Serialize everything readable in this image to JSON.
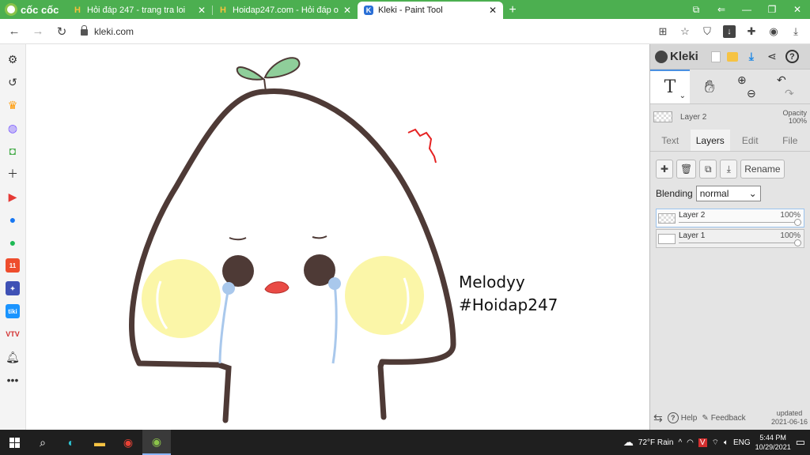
{
  "browser": {
    "brand": "cốc cốc",
    "tabs": [
      {
        "title": "Hỏi đáp 247 - trang tra loi",
        "icon": "hoidap-favicon",
        "active": false
      },
      {
        "title": "Hoidap247.com - Hỏi đáp or",
        "icon": "hoidap-favicon",
        "active": false
      },
      {
        "title": "Kleki - Paint Tool",
        "icon": "kleki-favicon",
        "active": true
      }
    ],
    "new_tab": "+",
    "url": "kleki.com"
  },
  "sidebar_icons": [
    "settings-icon",
    "history-icon",
    "crown-icon",
    "messenger-icon",
    "game-icon",
    "add-icon",
    "youtube-icon",
    "facebook-icon",
    "spotify-icon",
    "shopee-icon",
    "game-app-icon",
    "tiki-icon",
    "vtv-icon",
    "bell-icon",
    "more-icon"
  ],
  "canvas": {
    "text_line1": "Melodyy",
    "text_line2": "#Hoidap247",
    "colors": {
      "outline": "#4e3a36",
      "leaf": "#8fce9a",
      "cheek": "#fbf6a8",
      "tear": "#a9c8ec",
      "mouth": "#e94a45",
      "scribble": "#e52222"
    }
  },
  "kleki": {
    "app_name": "Kleki",
    "layer_info_name": "Layer 2",
    "opacity_label": "Opacity",
    "opacity_value": "100%",
    "tabs": [
      "Text",
      "Layers",
      "Edit",
      "File"
    ],
    "active_tab": "Layers",
    "rename_label": "Rename",
    "blending_label": "Blending",
    "blending_value": "normal",
    "layers": [
      {
        "name": "Layer 2",
        "opacity": "100%",
        "active": true
      },
      {
        "name": "Layer 1",
        "opacity": "100%",
        "active": false
      }
    ],
    "help_label": "Help",
    "feedback_label": "Feedback",
    "updated_label": "updated",
    "updated_date": "2021-06-16"
  },
  "taskbar": {
    "weather": "72°F  Rain",
    "lang": "ENG",
    "time": "5:44 PM",
    "date": "10/29/2021"
  }
}
